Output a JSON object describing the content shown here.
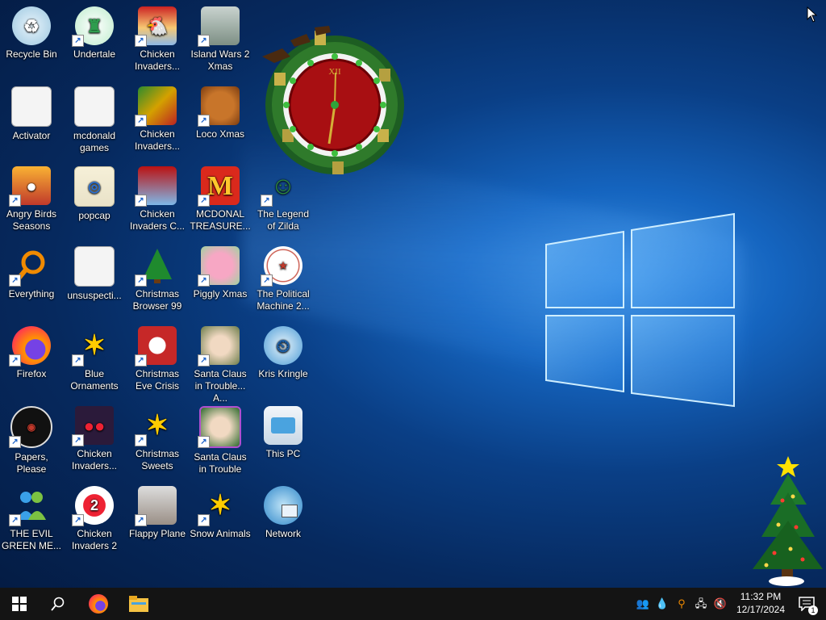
{
  "desktop_icons": [
    {
      "label": "Recycle Bin",
      "icon": "recycle-bin-icon"
    },
    {
      "label": "Undertale",
      "icon": "undertale-icon"
    },
    {
      "label": "Chicken Invaders...",
      "icon": "chicken-invaders-icon"
    },
    {
      "label": "Island Wars 2 Xmas",
      "icon": "island-wars-icon"
    },
    {
      "label": "Activator",
      "icon": "file-icon"
    },
    {
      "label": "mcdonald games",
      "icon": "folder-icon"
    },
    {
      "label": "Chicken Invaders...",
      "icon": "chicken-invaders-icon"
    },
    {
      "label": "Loco Xmas",
      "icon": "teddy-bear-icon"
    },
    {
      "label": "The Legend of Zilda",
      "icon": "zelda-icon"
    },
    {
      "label": "Angry Birds Seasons",
      "icon": "angry-birds-icon"
    },
    {
      "label": "popcap",
      "icon": "folder-icon"
    },
    {
      "label": "Chicken Invaders C...",
      "icon": "chicken-invaders-icon"
    },
    {
      "label": "MCDONAL TREASURE...",
      "icon": "mcdonalds-icon"
    },
    {
      "label": "Everything",
      "icon": "magnifier-icon"
    },
    {
      "label": "unsuspecti...",
      "icon": "file-icon"
    },
    {
      "label": "Christmas Browser 99",
      "icon": "christmas-tree-icon"
    },
    {
      "label": "Piggly Xmas",
      "icon": "pig-icon"
    },
    {
      "label": "The Political Machine 2...",
      "icon": "political-machine-icon"
    },
    {
      "label": "Firefox",
      "icon": "firefox-icon"
    },
    {
      "label": "Blue Ornaments",
      "icon": "popcap-game-icon"
    },
    {
      "label": "Christmas Eve Crisis",
      "icon": "santa-icon"
    },
    {
      "label": "Santa Claus in Trouble... A...",
      "icon": "santa-icon"
    },
    {
      "label": "Kris Kringle",
      "icon": "kris-kringle-icon"
    },
    {
      "label": "Papers, Please",
      "icon": "papers-please-icon"
    },
    {
      "label": "Chicken Invaders...",
      "icon": "chicken-invaders-icon"
    },
    {
      "label": "Christmas Sweets",
      "icon": "popcap-game-icon"
    },
    {
      "label": "Santa Claus in Trouble",
      "icon": "santa-icon"
    },
    {
      "label": "This PC",
      "icon": "computer-icon"
    },
    {
      "label": "THE EVIL GREEN ME...",
      "icon": "messenger-icon"
    },
    {
      "label": "Chicken Invaders 2",
      "icon": "chicken-invaders-icon"
    },
    {
      "label": "Flappy Plane",
      "icon": "flappy-plane-icon"
    },
    {
      "label": "Snow Animals",
      "icon": "popcap-game-icon"
    },
    {
      "label": "Network",
      "icon": "network-icon"
    }
  ],
  "taskbar": {
    "start_icon": "windows-start-icon",
    "search_icon": "search-icon",
    "pinned": [
      {
        "label": "Firefox",
        "icon": "firefox-icon"
      },
      {
        "label": "File Explorer",
        "icon": "file-explorer-icon"
      }
    ],
    "tray_icons": [
      "people-icon",
      "droplet-icon",
      "everything-search-icon",
      "network-wired-icon",
      "volume-muted-icon"
    ],
    "time": "11:32 PM",
    "date": "12/17/2024",
    "notification_count": "1"
  },
  "clock_text": "XII"
}
